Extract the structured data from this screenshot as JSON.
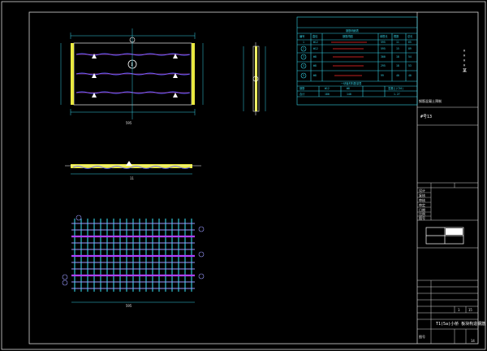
{
  "title_block": {
    "title_vertical": "××××某",
    "project_label": "钢筋混凝土预制",
    "drawing_no": "#号13",
    "drawing_name": "T1(5a)小桥 板块构造钢筋",
    "rows": [
      "设计",
      "复核",
      "审核",
      "审定",
      "日期",
      "比例",
      "图号"
    ],
    "sheet_row": [
      "1",
      "15"
    ],
    "sheet_num": "图号",
    "page_label": "14"
  },
  "quantity_table": {
    "title": "钢筋明细表",
    "header": [
      "编号",
      "直径",
      "钢筋简图",
      "单根长",
      "根数",
      "总长"
    ],
    "rows": [
      [
        "1",
        "Φ12",
        "",
        "595",
        "11",
        "65"
      ],
      [
        "2",
        "Φ12",
        "",
        "595",
        "15",
        "89"
      ],
      [
        "3",
        "Φ8",
        "",
        "300",
        "18",
        "54"
      ],
      [
        "4",
        "Φ8",
        "",
        "295",
        "18",
        "53"
      ],
      [
        "5",
        "Φ8",
        "",
        "99",
        "40",
        "40"
      ]
    ],
    "summary_title": "一块板材料数量表",
    "summary_header": [
      "钢筋",
      "Φ12",
      "Φ8",
      "混凝土(C30)"
    ],
    "summary_row": [
      "合计",
      "180",
      "148",
      "1.27"
    ]
  },
  "views": {
    "plan_dim": "595",
    "section_dim": "11",
    "rebar_dim": "595",
    "circle_label": "1"
  }
}
